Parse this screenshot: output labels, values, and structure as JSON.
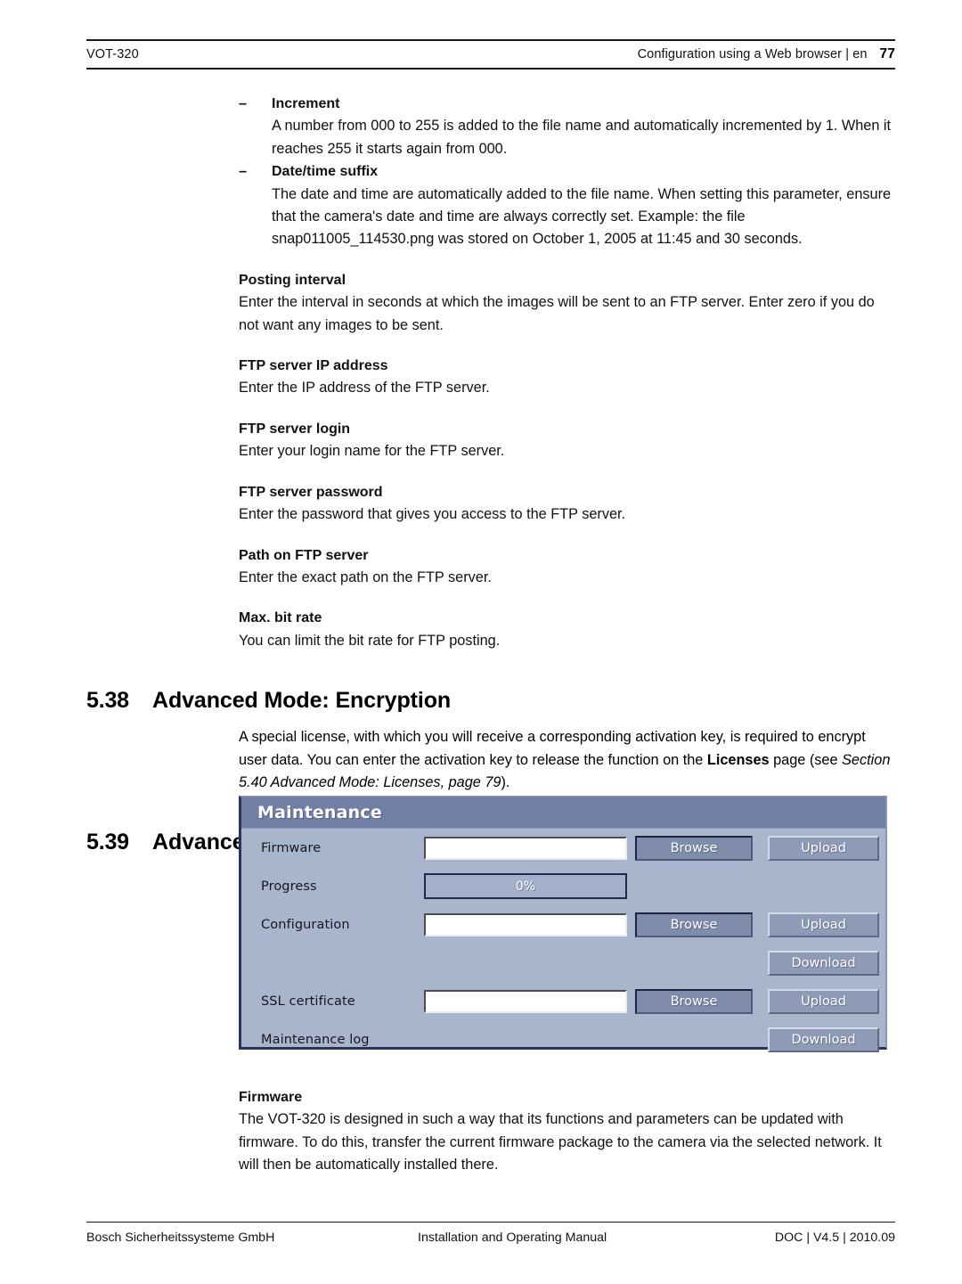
{
  "header": {
    "doc_model": "VOT-320",
    "breadcrumb": "Configuration using a Web browser | en",
    "page_number": "77"
  },
  "footer": {
    "company": "Bosch Sicherheitssysteme GmbH",
    "manual": "Installation and Operating Manual",
    "doc_version": "DOC | V4.5 | 2010.09"
  },
  "body": {
    "bullets": [
      {
        "dash": "–",
        "term": "Increment",
        "desc": "A number from 000 to 255 is added to the file name and automatically incremented by 1. When it reaches 255 it starts again from 000."
      },
      {
        "dash": "–",
        "term": "Date/time suffix",
        "desc": "The date and time are automatically added to the file name. When setting this parameter, ensure that the camera's date and time are always correctly set. Example: the file snap011005_114530.png was stored on October 1, 2005 at 11:45 and 30 seconds."
      }
    ],
    "terms": [
      {
        "term": "Posting interval",
        "desc": "Enter the interval in seconds at which the images will be sent to an FTP server. Enter zero if you do not want any images to be sent."
      },
      {
        "term": "FTP server IP address",
        "desc": "Enter the IP address of the FTP server."
      },
      {
        "term": "FTP server login",
        "desc": "Enter your login name for the FTP server."
      },
      {
        "term": "FTP server password",
        "desc": "Enter the password that gives you access to the FTP server."
      },
      {
        "term": "Path on FTP server",
        "desc": "Enter the exact path on the FTP server."
      },
      {
        "term": "Max. bit rate",
        "desc": "You can limit the bit rate for FTP posting."
      }
    ]
  },
  "sections": {
    "encryption": {
      "number": "5.38",
      "title": "Advanced Mode: Encryption",
      "para_part1": "A special license, with which you will receive a corresponding activation key, is required to encrypt user data. You can enter the activation key to release the function on the ",
      "para_bold": "Licenses",
      "para_part2": " page (see ",
      "para_italic": "Section 5.40 Advanced Mode: Licenses, page 79",
      "para_part3": ")."
    },
    "maintenance": {
      "number": "5.39",
      "title": "Advanced Mode: Maintenance"
    },
    "firmware": {
      "term": "Firmware",
      "desc": "The VOT-320 is designed in such a way that its functions and parameters can be updated with firmware. To do this, transfer the current firmware package to the camera via the selected network. It will then be automatically installed there."
    }
  },
  "maintenance_ui": {
    "panel_title": "Maintenance",
    "colors": {
      "panel_background": "#a9b5cd",
      "titlebar": "#6f7fa6",
      "button_primary": "#7f8cab",
      "button_secondary": "#8e9ab6",
      "input_background": "#ffffff",
      "progress_border": "#22284a"
    },
    "rows": [
      {
        "label": "Firmware",
        "field_value": "",
        "browse_label": "Browse",
        "action_label": "Upload"
      },
      {
        "label": "Progress",
        "progress_text": "0%",
        "progress_percent": 0
      },
      {
        "label": "Configuration",
        "field_value": "",
        "browse_label": "Browse",
        "action_label": "Upload"
      },
      {
        "label": "",
        "action_label": "Download"
      },
      {
        "label": "SSL certificate",
        "field_value": "",
        "browse_label": "Browse",
        "action_label": "Upload"
      },
      {
        "label": "Maintenance log",
        "action_label": "Download"
      }
    ]
  }
}
